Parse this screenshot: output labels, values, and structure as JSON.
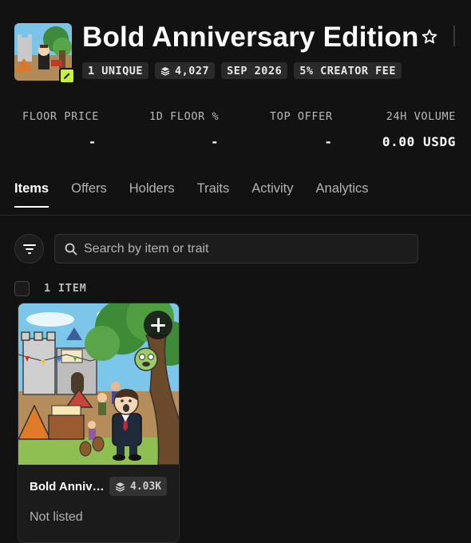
{
  "collection": {
    "title": "Bold Anniversary Edition",
    "badges": {
      "unique": "1 UNIQUE",
      "supply": "4,027",
      "date": "SEP 2026",
      "fee": "5% CREATOR FEE"
    }
  },
  "stats": [
    {
      "label": "FLOOR PRICE",
      "value": "-"
    },
    {
      "label": "1D FLOOR %",
      "value": "-"
    },
    {
      "label": "TOP OFFER",
      "value": "-"
    },
    {
      "label": "24H VOLUME",
      "value": "0.00 USDG"
    }
  ],
  "tabs": [
    {
      "label": "Items",
      "active": true
    },
    {
      "label": "Offers"
    },
    {
      "label": "Holders"
    },
    {
      "label": "Traits"
    },
    {
      "label": "Activity"
    },
    {
      "label": "Analytics"
    }
  ],
  "search": {
    "placeholder": "Search by item or trait"
  },
  "results": {
    "count_label": "1 ITEM"
  },
  "items": [
    {
      "name": "Bold Anniversary Edition",
      "supply": "4.03K",
      "status": "Not listed"
    }
  ],
  "colors": {
    "background": "#121212",
    "accent": "#c6f432",
    "badge_bg": "#2a2a2a"
  },
  "icons": {
    "star": "star-outline-icon",
    "edit": "pencil-icon",
    "layers": "layers-icon",
    "filter": "filter-lines-icon",
    "search": "magnifier-icon",
    "add": "plus-icon"
  }
}
